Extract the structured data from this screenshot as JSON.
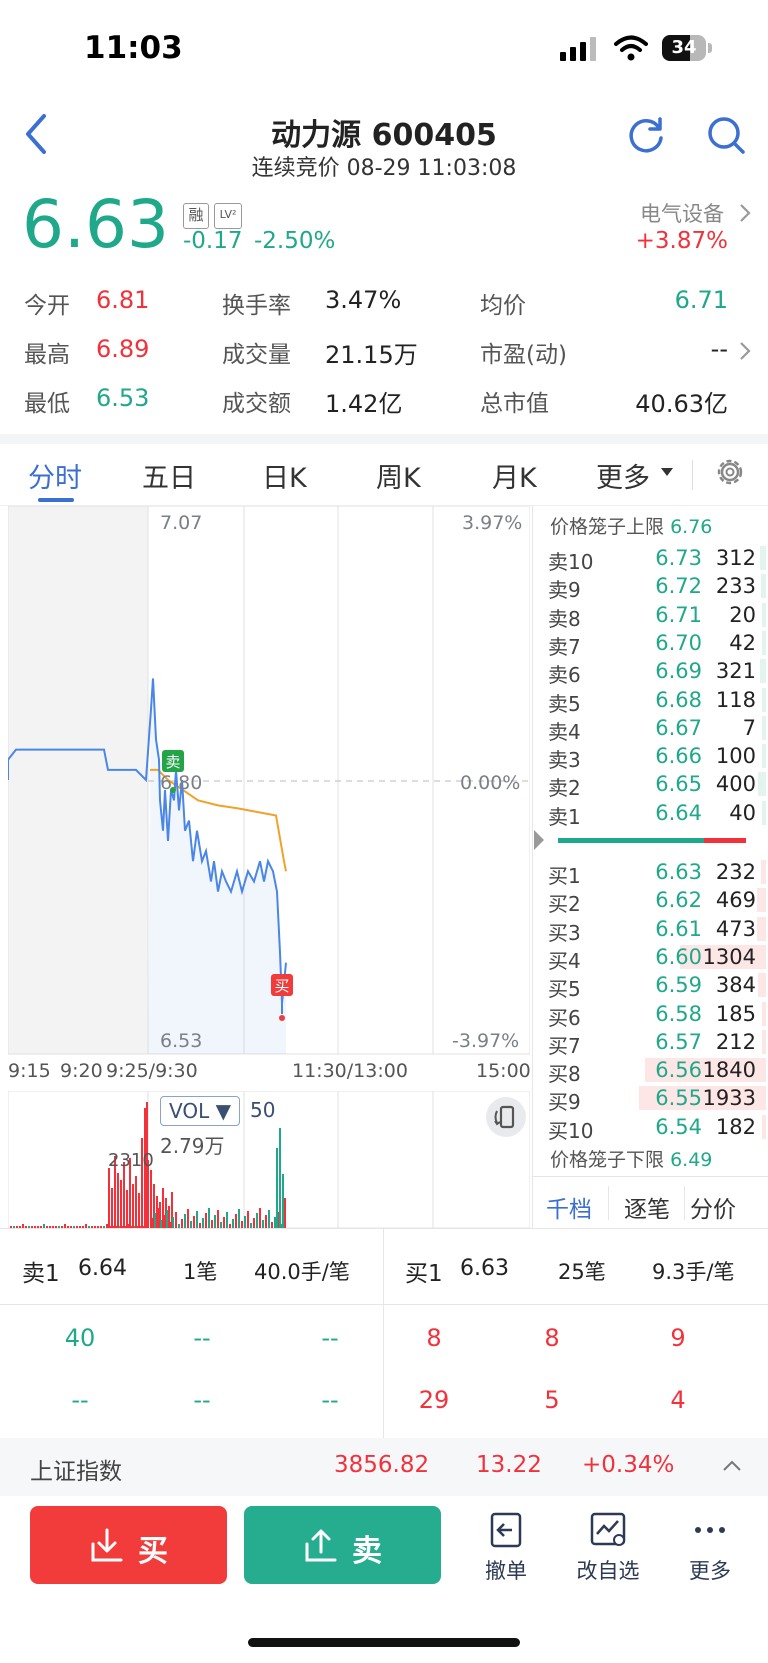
{
  "status_bar": {
    "time": "11:03",
    "battery": "34"
  },
  "header": {
    "title": "动力源 600405",
    "subtitle": "连续竞价 08-29 11:03:08"
  },
  "quote": {
    "price": "6.63",
    "tag_rong": "融",
    "tag_lv": "LV²",
    "change": "-0.17",
    "change_pct": "-2.50%",
    "industry": "电气设备",
    "industry_pct": "+3.87%"
  },
  "stats": [
    [
      {
        "label": "今开",
        "value": "6.81",
        "color": "red"
      },
      {
        "label": "换手率",
        "value": "3.47%",
        "color": "black"
      },
      {
        "label": "均价",
        "value": "6.71",
        "color": "green"
      }
    ],
    [
      {
        "label": "最高",
        "value": "6.89",
        "color": "red"
      },
      {
        "label": "成交量",
        "value": "21.15万",
        "color": "black"
      },
      {
        "label": "市盈(动)",
        "value": "--",
        "color": "black"
      }
    ],
    [
      {
        "label": "最低",
        "value": "6.53",
        "color": "green"
      },
      {
        "label": "成交额",
        "value": "1.42亿",
        "color": "black"
      },
      {
        "label": "总市值",
        "value": "40.63亿",
        "color": "black"
      }
    ]
  ],
  "tabs": [
    "分时",
    "五日",
    "日K",
    "周K",
    "月K",
    "更多"
  ],
  "active_tab": "分时",
  "chart": {
    "price_top": "7.07",
    "price_mid": "6.80",
    "price_bot": "6.53",
    "pct_top": "3.97%",
    "pct_mid": "0.00%",
    "pct_bot": "-3.97%",
    "time_labels": [
      "9:15",
      "9:20",
      "9:25/9:30",
      "11:30/13:00",
      "15:00"
    ],
    "marker_sell": "卖",
    "marker_buy": "买",
    "vol_label": "VOL ▼",
    "vol_period": "50",
    "vol_amount": "2.79万",
    "vol_max": "2310"
  },
  "orderbook": {
    "cage_upper_label": "价格笼子上限",
    "cage_upper": "6.76",
    "cage_lower_label": "价格笼子下限",
    "cage_lower": "6.49",
    "asks": [
      {
        "label": "卖10",
        "price": "6.73",
        "vol": "312",
        "bar": 0.05
      },
      {
        "label": "卖9",
        "price": "6.72",
        "vol": "233",
        "bar": 0.04
      },
      {
        "label": "卖8",
        "price": "6.71",
        "vol": "20",
        "bar": 0.01
      },
      {
        "label": "卖7",
        "price": "6.70",
        "vol": "42",
        "bar": 0.01
      },
      {
        "label": "卖6",
        "price": "6.69",
        "vol": "321",
        "bar": 0.05
      },
      {
        "label": "卖5",
        "price": "6.68",
        "vol": "118",
        "bar": 0.02
      },
      {
        "label": "卖4",
        "price": "6.67",
        "vol": "7",
        "bar": 0.01
      },
      {
        "label": "卖3",
        "price": "6.66",
        "vol": "100",
        "bar": 0.02
      },
      {
        "label": "卖2",
        "price": "6.65",
        "vol": "400",
        "bar": 0.06
      },
      {
        "label": "卖1",
        "price": "6.64",
        "vol": "40",
        "bar": 0.01
      }
    ],
    "bids": [
      {
        "label": "买1",
        "price": "6.63",
        "vol": "232",
        "bar": 0.04
      },
      {
        "label": "买2",
        "price": "6.62",
        "vol": "469",
        "bar": 0.07
      },
      {
        "label": "买3",
        "price": "6.61",
        "vol": "473",
        "bar": 0.07
      },
      {
        "label": "买4",
        "price": "6.60",
        "vol": "1304",
        "bar": 0.66
      },
      {
        "label": "买5",
        "price": "6.59",
        "vol": "384",
        "bar": 0.06
      },
      {
        "label": "买6",
        "price": "6.58",
        "vol": "185",
        "bar": 0.03
      },
      {
        "label": "买7",
        "price": "6.57",
        "vol": "212",
        "bar": 0.03
      },
      {
        "label": "买8",
        "price": "6.56",
        "vol": "1840",
        "bar": 0.93
      },
      {
        "label": "买9",
        "price": "6.55",
        "vol": "1933",
        "bar": 0.98
      },
      {
        "label": "买10",
        "price": "6.54",
        "vol": "182",
        "bar": 0.03
      }
    ],
    "tabs": [
      "千档",
      "逐笔",
      "分价"
    ]
  },
  "level1": {
    "sell_label": "卖1",
    "sell_price": "6.64",
    "sell_orders": "1笔",
    "sell_avg": "40.0手/笔",
    "buy_label": "买1",
    "buy_price": "6.63",
    "buy_orders": "25笔",
    "buy_avg": "9.3手/笔",
    "sell_rows": [
      [
        "40",
        "--",
        "--"
      ],
      [
        "--",
        "--",
        "--"
      ]
    ],
    "buy_rows": [
      [
        "8",
        "8",
        "9"
      ],
      [
        "29",
        "5",
        "4"
      ]
    ]
  },
  "index": {
    "name": "上证指数",
    "value": "3856.82",
    "change": "13.22",
    "pct": "+0.34%"
  },
  "actions": {
    "buy": "买",
    "sell": "卖",
    "cancel": "撤单",
    "watchlist": "改自选",
    "more": "更多"
  }
}
